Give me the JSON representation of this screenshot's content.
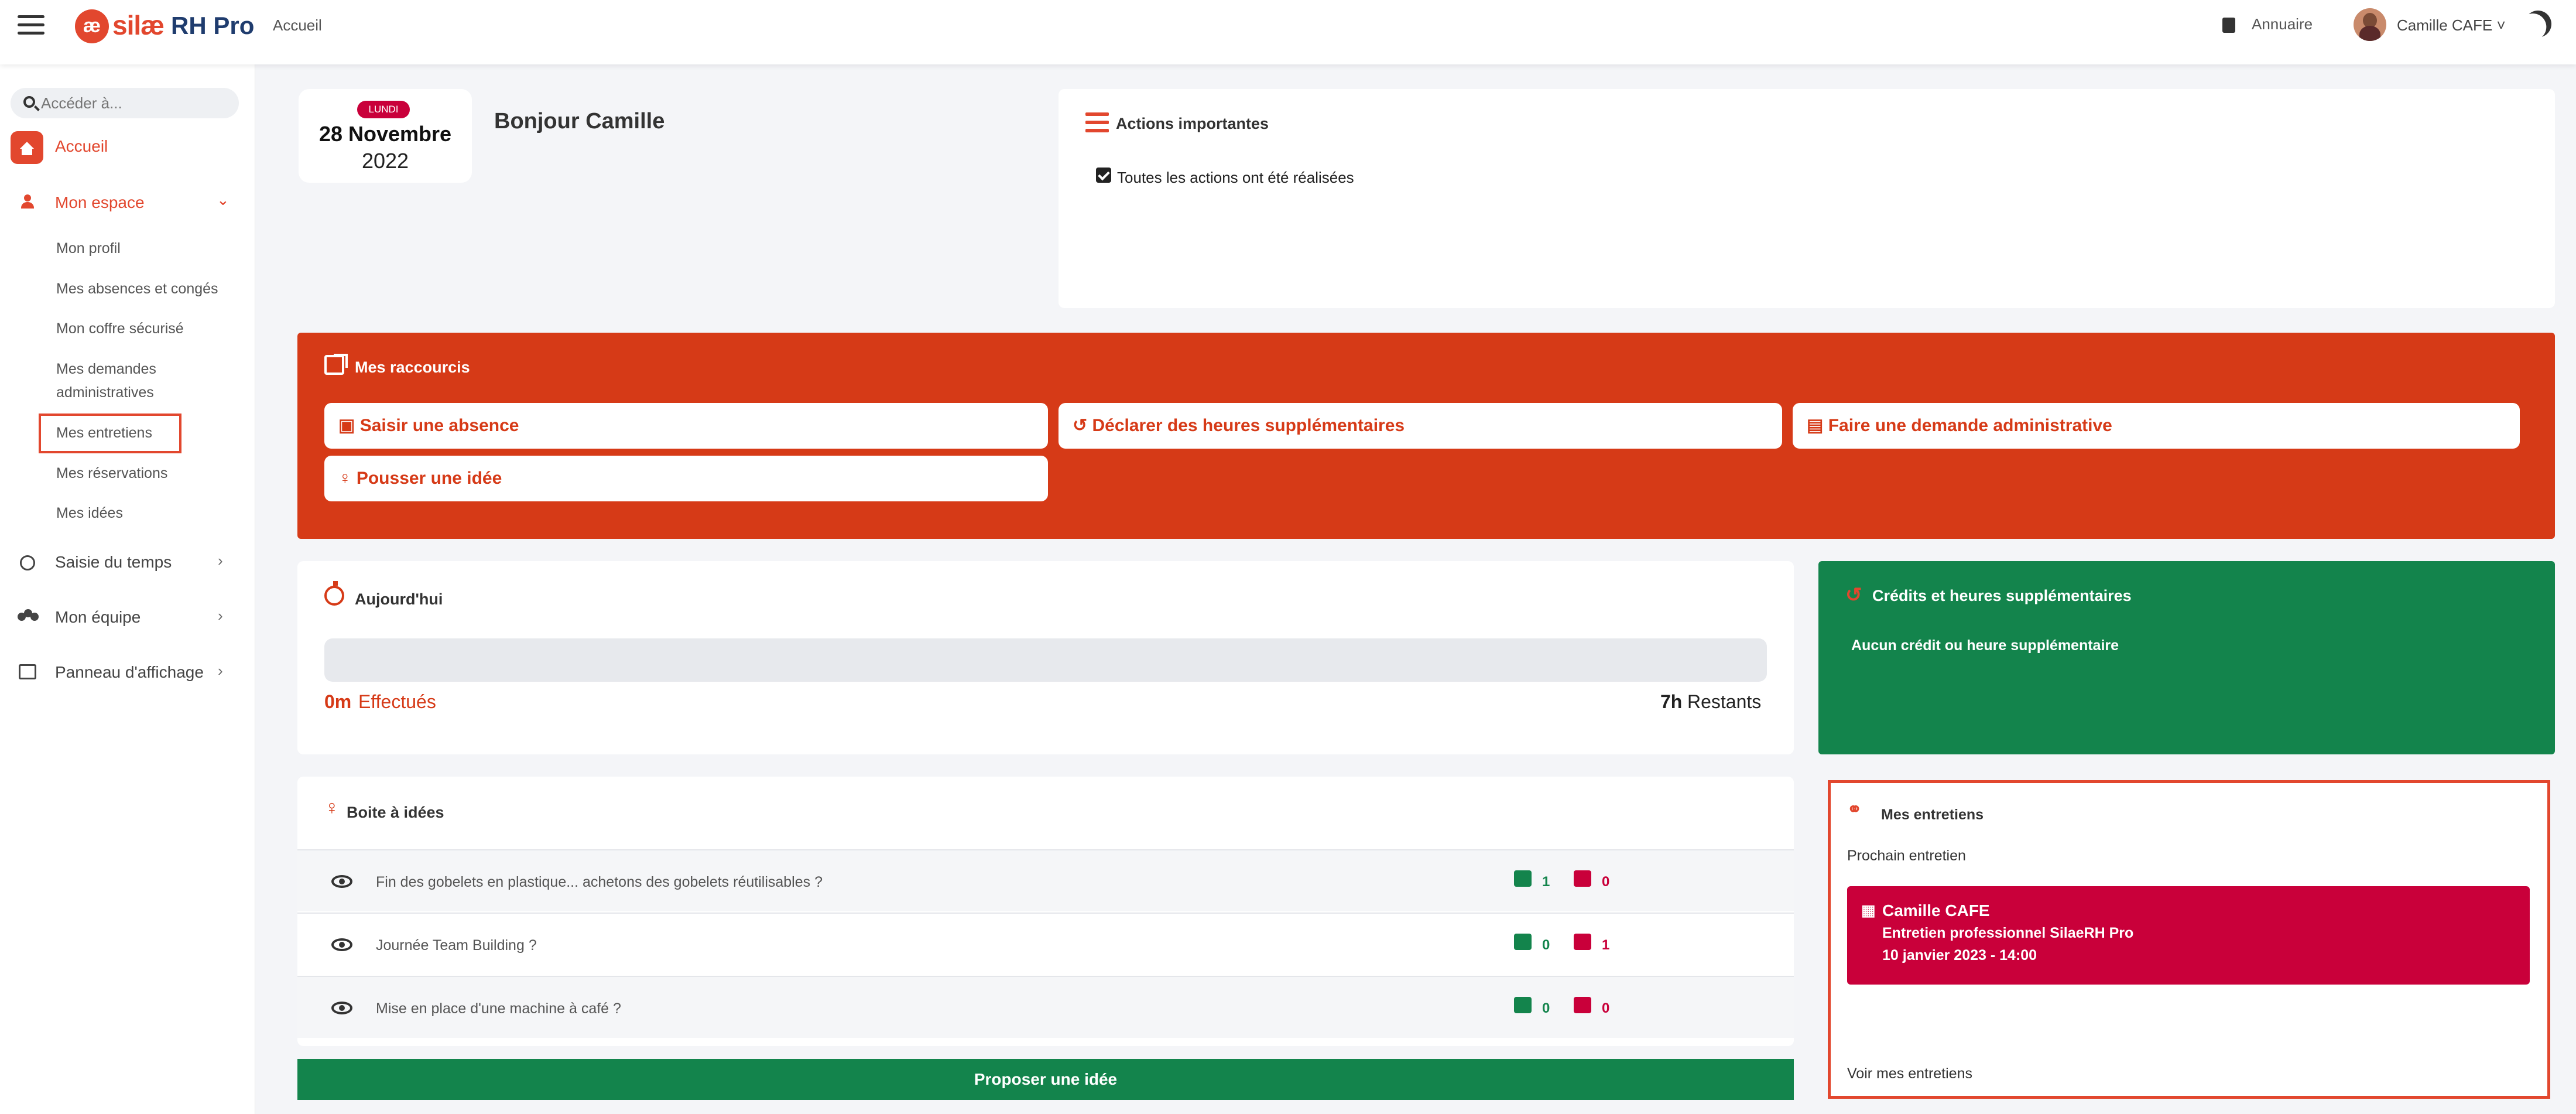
{
  "header": {
    "logo_mark": "æ",
    "logo_text": "silæ",
    "logo_product": "RH Pro",
    "breadcrumb": "Accueil",
    "directory_label": "Annuaire",
    "user_name": "Camille CAFE ˅"
  },
  "sidebar": {
    "search_placeholder": "Accéder à...",
    "home_label": "Accueil",
    "my_space_label": "Mon espace",
    "my_space_items": [
      "Mon profil",
      "Mes absences et congés",
      "Mon coffre sécurisé",
      "Mes demandes administratives",
      "Mes entretiens",
      "Mes réservations",
      "Mes idées"
    ],
    "time_entry_label": "Saisie du temps",
    "my_team_label": "Mon équipe",
    "board_label": "Panneau d'affichage"
  },
  "date_card": {
    "weekday": "LUNDI",
    "day_month": "28 Novembre",
    "year": "2022"
  },
  "greeting": "Bonjour Camille",
  "important_actions": {
    "title": "Actions importantes",
    "status_text": "Toutes les actions ont été réalisées",
    "checked": true
  },
  "shortcuts": {
    "title": "Mes raccourcis",
    "buttons": [
      "Saisir une absence",
      "Déclarer des heures supplémentaires",
      "Faire une demande administrative",
      "Pousser une idée"
    ]
  },
  "today": {
    "title": "Aujourd'hui",
    "done_value": "0m",
    "done_label": "Effectués",
    "remaining_value": "7h",
    "remaining_label": "Restants",
    "progress_fraction": 0
  },
  "credits": {
    "title": "Crédits et heures supplémentaires",
    "message": "Aucun crédit ou heure supplémentaire"
  },
  "ideas": {
    "title": "Boite à idées",
    "items": [
      {
        "text": "Fin des gobelets en plastique... achetons des gobelets réutilisables ?",
        "likes": "1",
        "dislikes": "0"
      },
      {
        "text": "Journée Team Building ?",
        "likes": "0",
        "dislikes": "1"
      },
      {
        "text": "Mise en place d'une machine à café ?",
        "likes": "0",
        "dislikes": "0"
      }
    ],
    "propose_button": "Proposer une idée"
  },
  "interviews": {
    "title": "Mes entretiens",
    "next_label": "Prochain entretien",
    "next": {
      "person": "Camille CAFE",
      "type": "Entretien professionnel SilaeRH Pro",
      "datetime": "10 janvier 2023 - 14:00"
    },
    "see_all": "Voir mes entretiens"
  },
  "colors": {
    "brand_red": "#e2472e",
    "shortcut_red": "#d63a17",
    "green": "#13844c",
    "crimson": "#c9003a"
  }
}
